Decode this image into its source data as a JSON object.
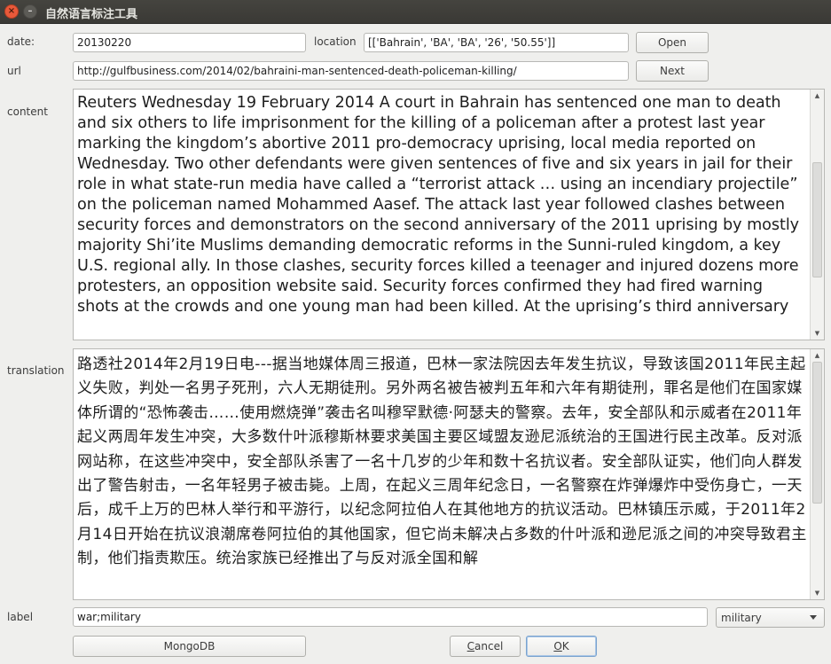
{
  "window": {
    "title": "自然语言标注工具"
  },
  "form": {
    "date_label": "date:",
    "date_value": "20130220",
    "location_label": "location",
    "location_value": "[['Bahrain', 'BA', 'BA', '26', '50.55']]",
    "url_label": "url",
    "url_value": "http://gulfbusiness.com/2014/02/bahraini-man-sentenced-death-policeman-killing/",
    "content_label": "content",
    "content_text": "Reuters Wednesday 19 February 2014 A court in Bahrain has sentenced one man to death and six others to life imprisonment for the killing of a policeman after a protest last year marking the kingdom’s abortive 2011 pro-democracy uprising, local media reported on Wednesday. Two other defendants were given sentences of five and six years in jail for their role in what state-run media have called a “terrorist attack … using an incendiary projectile” on the policeman named Mohammed Aasef. The attack last year followed clashes between security forces and demonstrators on the second anniversary of the 2011 uprising by mostly majority Shi’ite Muslims demanding democratic reforms in the Sunni-ruled kingdom, a key U.S. regional ally. In those clashes, security forces killed a teenager and injured dozens more protesters, an opposition website said. Security forces confirmed they had fired warning shots at the crowds and one young man had been killed. At the uprising’s third anniversary",
    "translation_label": "translation",
    "translation_text": "路透社2014年2月19日电---据当地媒体周三报道，巴林一家法院因去年发生抗议，导致该国2011年民主起义失败，判处一名男子死刑，六人无期徒刑。另外两名被告被判五年和六年有期徒刑，罪名是他们在国家媒体所谓的“恐怖袭击……使用燃烧弹”袭击名叫穆罕默德·阿瑟夫的警察。去年，安全部队和示威者在2011年起义两周年发生冲突，大多数什叶派穆斯林要求美国主要区域盟友逊尼派统治的王国进行民主改革。反对派网站称，在这些冲突中，安全部队杀害了一名十几岁的少年和数十名抗议者。安全部队证实，他们向人群发出了警告射击，一名年轻男子被击毙。上周，在起义三周年纪念日，一名警察在炸弹爆炸中受伤身亡，一天后，成千上万的巴林人举行和平游行，以纪念阿拉伯人在其他地方的抗议活动。巴林镇压示威，于2011年2月14日开始在抗议浪潮席卷阿拉伯的其他国家，但它尚未解决占多数的什叶派和逊尼派之间的冲突导致君主制，他们指责欺压。统治家族已经推出了与反对派全国和解",
    "label_label": "label",
    "label_value": "war;military",
    "label_select": "military"
  },
  "buttons": {
    "open": "Open",
    "next": "Next",
    "mongodb": "MongoDB",
    "cancel_prefix": "",
    "cancel_mnemonic": "C",
    "cancel_rest": "ancel",
    "ok_prefix": "",
    "ok_mnemonic": "O",
    "ok_rest": "K"
  },
  "scroll": {
    "content_position": 0.55,
    "translation_position": 0.0
  },
  "colors": {
    "close_button": "#e9593a",
    "titlebar": "#3a3935",
    "background": "#efefed"
  }
}
